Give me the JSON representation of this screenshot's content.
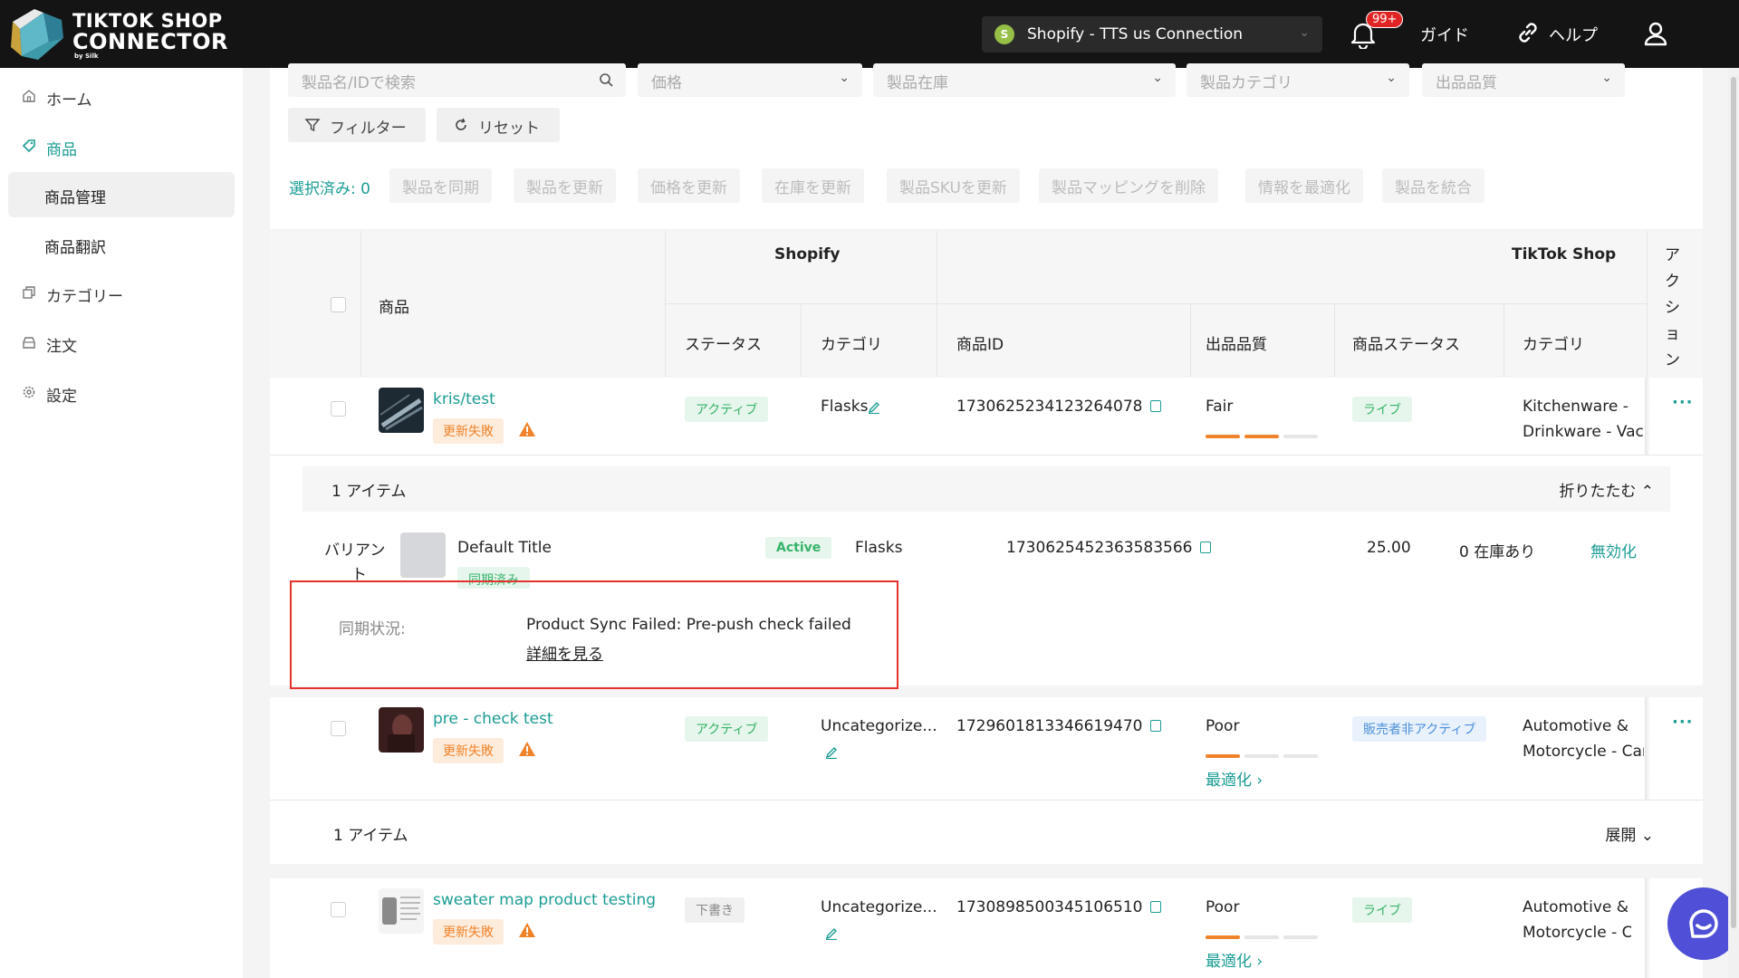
{
  "topbar": {
    "brand_line1": "TIKTOK SHOP",
    "brand_line2": "CONNECTOR",
    "brand_line3": "by Silk",
    "connection": "Shopify - TTS us Connection",
    "notification_badge": "99+",
    "guide": "ガイド",
    "help": "ヘルプ"
  },
  "sidebar": {
    "home": "ホーム",
    "products": "商品",
    "product_management": "商品管理",
    "product_translation": "商品翻訳",
    "categories": "カテゴリー",
    "orders": "注文",
    "settings": "設定"
  },
  "filters": {
    "search_placeholder": "製品名/IDで検索",
    "price": "価格",
    "inventory": "製品在庫",
    "category": "製品カテゴリ",
    "listing_quality": "出品品質",
    "filter_btn": "フィルター",
    "reset_btn": "リセット"
  },
  "bulk": {
    "selected": "選択済み: 0",
    "actions": [
      "製品を同期",
      "製品を更新",
      "価格を更新",
      "在庫を更新",
      "製品SKUを更新",
      "製品マッピングを削除",
      "情報を最適化",
      "製品を統合"
    ]
  },
  "table_head": {
    "product": "商品",
    "shopify": "Shopify",
    "tiktok": "TikTok Shop",
    "action": "アクション",
    "status": "ステータス",
    "category": "カテゴリ",
    "product_id": "商品ID",
    "quality": "出品品質",
    "product_status": "商品ステータス",
    "tt_category": "カテゴリ"
  },
  "rows": [
    {
      "name": "kris/test",
      "fail_tag": "更新失敗",
      "status": "アクティブ",
      "category": "Flasks",
      "product_id": "1730625234123264078",
      "quality": "Fair",
      "tt_status": "ライブ",
      "tt_category_1": "Kitchenware -",
      "tt_category_2": "Drinkware - Vacu...",
      "more": "···"
    },
    {
      "name": "pre - check test",
      "fail_tag": "更新失敗",
      "status": "アクティブ",
      "category": "Uncategorize...",
      "product_id": "1729601813346619470",
      "quality": "Poor",
      "optimize": "最適化 ›",
      "tt_status": "販売者非アクティブ",
      "tt_category_1": "Automotive &",
      "tt_category_2": "Motorcycle - Car ...",
      "more": "···"
    },
    {
      "name": "sweater map product testing",
      "fail_tag": "更新失敗",
      "status": "下書き",
      "category": "Uncategorize...",
      "product_id": "1730898500345106510",
      "quality": "Poor",
      "optimize": "最適化 ›",
      "tt_status": "ライブ",
      "tt_category_1": "Automotive &",
      "tt_category_2": "Motorcycle - Car..."
    }
  ],
  "items1": {
    "count": "1 アイテム",
    "toggle": "折りたたむ ⌃"
  },
  "variant": {
    "label_1": "バリアン",
    "label_2": "ト",
    "title": "Default Title",
    "tag": "同期済み",
    "status": "Active",
    "category": "Flasks",
    "id": "1730625452363583566",
    "price": "25.00",
    "stock": "0 在庫あり",
    "disable": "無効化"
  },
  "sync": {
    "label": "同期状況:",
    "message": "Product Sync Failed: Pre-push check failed",
    "details": "詳細を見る"
  },
  "items2": {
    "count": "1 アイテム",
    "toggle": "展開 ⌄"
  },
  "colors": {
    "accent": "#1a9c93",
    "warning": "#f0822a",
    "highlight": "#e5322d",
    "chat": "#4f4fd7"
  },
  "quality_levels": {
    "kris_test": 2,
    "pre_check_test": 1,
    "sweater": 1,
    "max": 3
  }
}
